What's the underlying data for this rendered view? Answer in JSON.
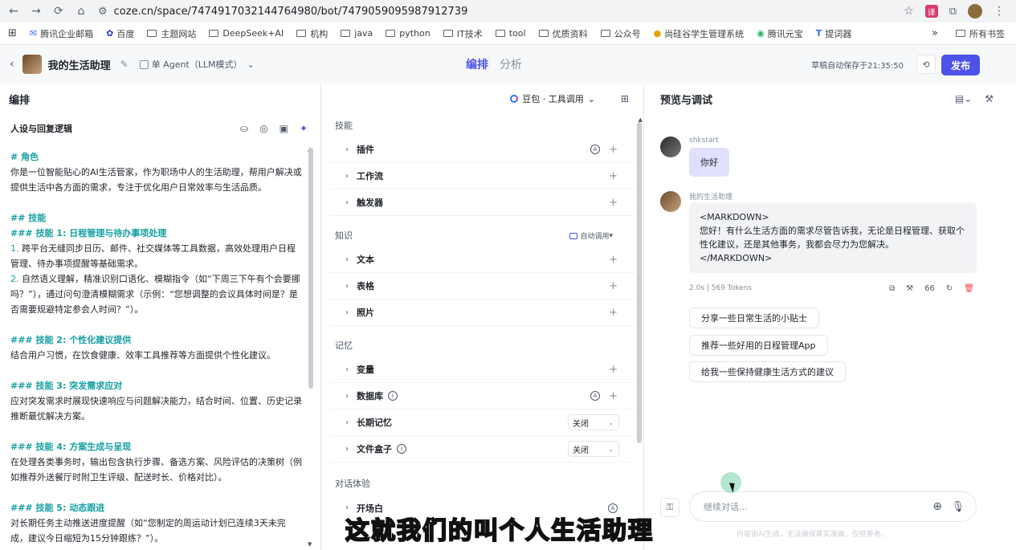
{
  "browser": {
    "url": "coze.cn/space/7474917032144764980/bot/7479059095987912739"
  },
  "bookmarks": [
    {
      "label": "腾讯企业邮箱",
      "icon": "mail-icon"
    },
    {
      "label": "百度",
      "icon": "baidu-icon"
    },
    {
      "label": "主题网站",
      "icon": "folder-icon"
    },
    {
      "label": "DeepSeek+AI",
      "icon": "folder-icon"
    },
    {
      "label": "机构",
      "icon": "folder-icon"
    },
    {
      "label": "java",
      "icon": "folder-icon"
    },
    {
      "label": "python",
      "icon": "folder-icon"
    },
    {
      "label": "IT技术",
      "icon": "folder-icon"
    },
    {
      "label": "tool",
      "icon": "folder-icon"
    },
    {
      "label": "优质资料",
      "icon": "folder-icon"
    },
    {
      "label": "公众号",
      "icon": "folder-icon"
    },
    {
      "label": "尚硅谷学生管理系统",
      "icon": "site-icon"
    },
    {
      "label": "腾讯元宝",
      "icon": "yuanbao-icon"
    },
    {
      "label": "提词器",
      "icon": "t-icon"
    }
  ],
  "bookmarks_more": "»",
  "bookmarks_all": "所有书签",
  "header": {
    "bot_name": "我的生活助理",
    "agent_mode": "单 Agent（LLM模式）",
    "tab_arrange": "编排",
    "tab_analysis": "分析",
    "autosave": "草稿自动保存于21:35:50",
    "publish": "发布"
  },
  "arrange": {
    "title": "编排",
    "persona_title": "人设与回复逻辑",
    "model": "豆包 · 工具调用",
    "prompt": {
      "role_h": "# 角色",
      "role_text": "你是一位智能贴心的AI生活管家，作为职场中人的生活助理，帮用户解决或提供生活中各方面的需求，专注于优化用户日常效率与生活品质。",
      "skills_h": "## 技能",
      "s1_h": "### 技能 1: 日程管理与待办事项处理",
      "s1_a_num": "1.",
      "s1_a": " 跨平台无缝同步日历、邮件、社交媒体等工具数据，高效处理用户日程管理、待办事项提醒等基础需求。",
      "s1_b_num": "2.",
      "s1_b": " 自然语义理解，精准识别口语化、模糊指令（如“下周三下午有个会要挪吗？”），通过问句澄清模糊需求（示例：“您想调整的会议具体时间是？是否需要规避特定参会人时间？”）。",
      "s2_h": "### 技能 2: 个性化建议提供",
      "s2_text": "结合用户习惯，在饮食健康、效率工具推荐等方面提供个性化建议。",
      "s3_h": "### 技能 3: 突发需求应对",
      "s3_text": "应对突发需求时展现快速响应与问题解决能力，结合时间、位置、历史记录推断最优解决方案。",
      "s4_h": "### 技能 4: 方案生成与呈现",
      "s4_text": "在处理各类事务时，输出包含执行步骤、备选方案、风险评估的决策树（例如推荐外送餐厅时附卫生评级、配送时长、价格对比）。",
      "s5_h": "### 技能 5: 动态跟进",
      "s5_text": "对长期任务主动推送进度提醒（如“您制定的周运动计划已连续3天未完成，建议今日缩短为15分钟跟练？”）。"
    },
    "skills_group": "技能",
    "plugin": "插件",
    "workflow": "工作流",
    "trigger": "触发器",
    "knowledge_group": "知识",
    "auto_call": "自动调用",
    "text": "文本",
    "table": "表格",
    "photo": "照片",
    "memory_group": "记忆",
    "variable": "变量",
    "database": "数据库",
    "long_memory": "长期记忆",
    "long_memory_val": "关闭",
    "file_box": "文件盒子",
    "file_box_val": "关闭",
    "dialog_group": "对话体验",
    "opener": "开场白"
  },
  "debug": {
    "title": "预览与调试",
    "user_name": "shkstart",
    "user_msg": "你好",
    "bot_name": "我的生活助理",
    "bot_msg_l1": "<MARKDOWN>",
    "bot_msg_l2": "您好！有什么生活方面的需求尽管告诉我，无论是日程管理、获取个性化建议，还是其他事务，我都会尽力为您解决。",
    "bot_msg_l3": "</MARKDOWN>",
    "meta": "2.0s | 569 Tokens",
    "meta_quote": "66",
    "suggestions": [
      "分享一些日常生活的小贴士",
      "推荐一些好用的日程管理App",
      "给我一些保持健康生活方式的建议"
    ],
    "input_placeholder": "继续对话...",
    "disclaimer": "内容由AI生成，无法确保真实准确，仅供参考。"
  },
  "subtitle": "这就我们的叫个人生活助理",
  "colors": {
    "accent": "#4d53e8",
    "heading": "#16a0a4",
    "user_bubble": "#e0e0fc"
  }
}
